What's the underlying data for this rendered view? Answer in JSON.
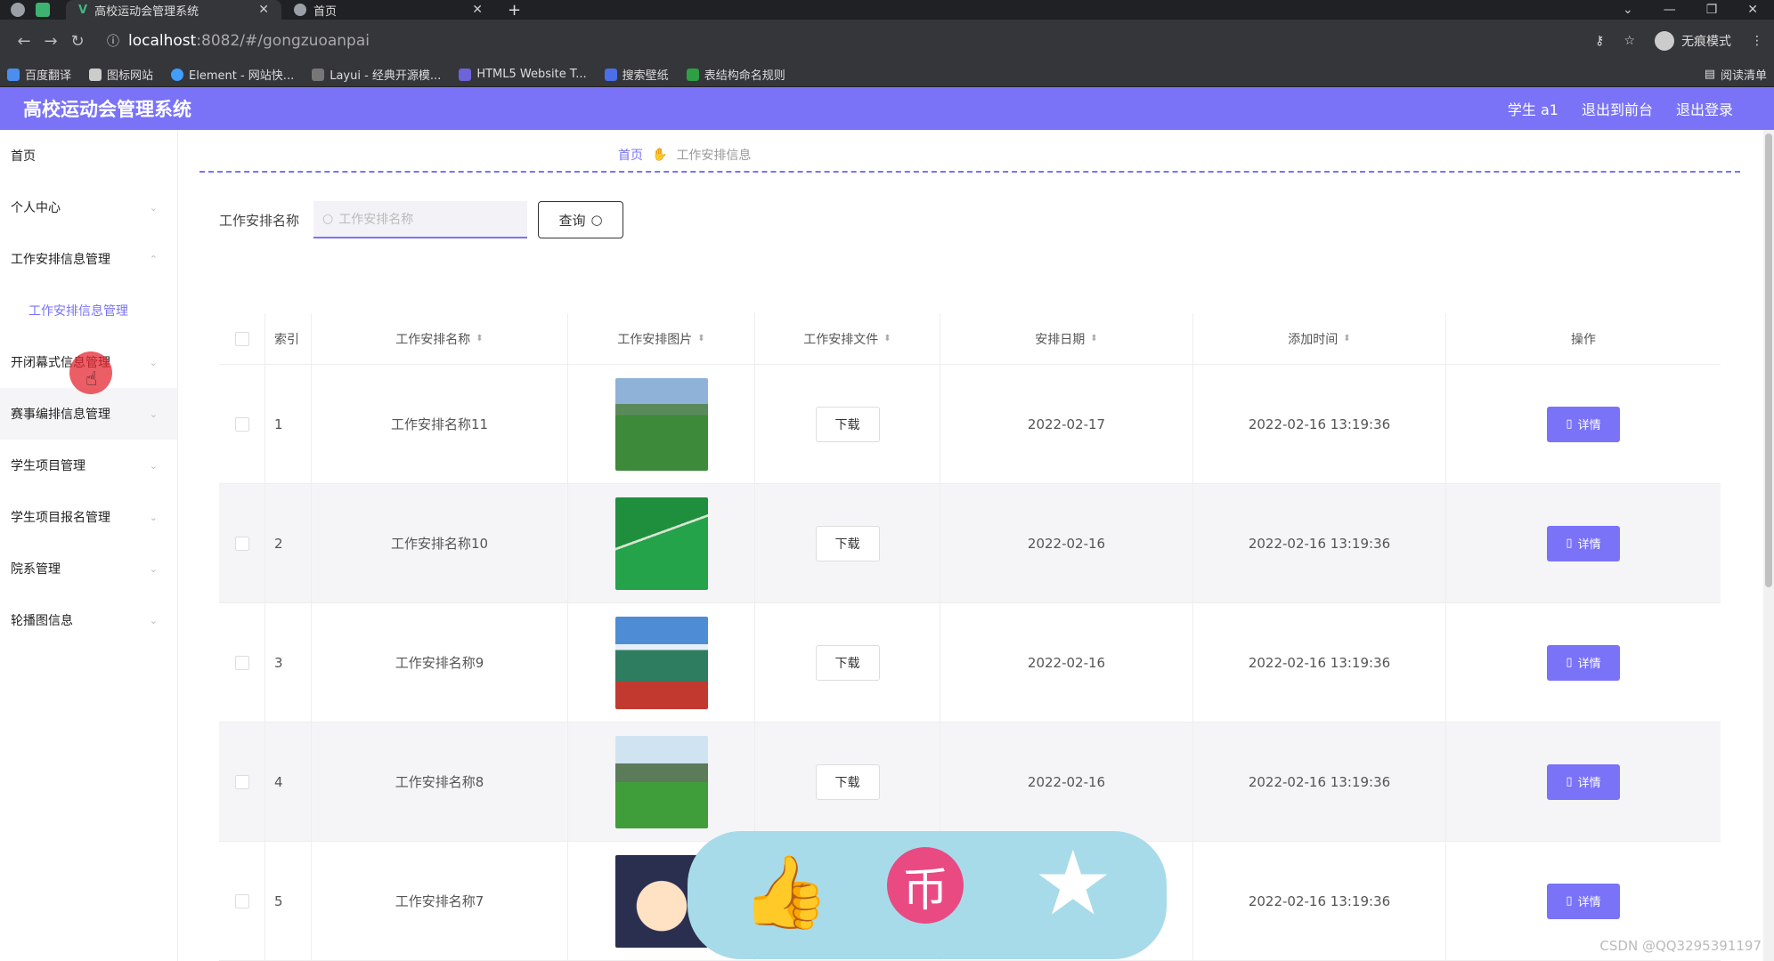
{
  "browser": {
    "tabs": [
      {
        "label": "高校运动会管理系统"
      },
      {
        "label": "首页"
      }
    ],
    "url_host": "localhost",
    "url_path": ":8082/#/gongzuoanpai",
    "profile": "无痕模式",
    "bookmarks": [
      "百度翻译",
      "图标网站",
      "Element - 网站快...",
      "Layui - 经典开源模...",
      "HTML5 Website T...",
      "搜索壁纸",
      "表结构命名规则"
    ],
    "reading_list": "阅读清单"
  },
  "header": {
    "title": "高校运动会管理系统",
    "links": [
      "学生 a1",
      "退出到前台",
      "退出登录"
    ]
  },
  "sidebar": {
    "items": [
      {
        "label": "首页"
      },
      {
        "label": "个人中心"
      },
      {
        "label": "工作安排信息管理"
      },
      {
        "label": "工作安排信息管理"
      },
      {
        "label": "开闭幕式信息管理"
      },
      {
        "label": "赛事编排信息管理"
      },
      {
        "label": "学生项目管理"
      },
      {
        "label": "学生项目报名管理"
      },
      {
        "label": "院系管理"
      },
      {
        "label": "轮播图信息"
      }
    ]
  },
  "breadcrumb": {
    "home": "首页",
    "current": "工作安排信息"
  },
  "search": {
    "label": "工作安排名称",
    "placeholder": "工作安排名称",
    "button": "查询"
  },
  "table": {
    "headers": [
      "索引",
      "工作安排名称",
      "工作安排图片",
      "工作安排文件",
      "安排日期",
      "添加时间",
      "操作"
    ],
    "rows": [
      {
        "index": "1",
        "name": "工作安排名称11",
        "file": "下载",
        "date": "2022-02-17",
        "added": "2022-02-16 13:19:36",
        "action": "详情"
      },
      {
        "index": "2",
        "name": "工作安排名称10",
        "file": "下载",
        "date": "2022-02-16",
        "added": "2022-02-16 13:19:36",
        "action": "详情"
      },
      {
        "index": "3",
        "name": "工作安排名称9",
        "file": "下载",
        "date": "2022-02-16",
        "added": "2022-02-16 13:19:36",
        "action": "详情"
      },
      {
        "index": "4",
        "name": "工作安排名称8",
        "file": "下载",
        "date": "2022-02-16",
        "added": "2022-02-16 13:19:36",
        "action": "详情"
      },
      {
        "index": "5",
        "name": "工作安排名称7",
        "file": "",
        "date": "",
        "added": "2022-02-16 13:19:36",
        "action": "详情"
      }
    ]
  },
  "watermark": "CSDN @QQ3295391197",
  "colors": {
    "accent": "#7a73f7",
    "overlay": "#a7dbe9",
    "pink": "#e94a82"
  }
}
